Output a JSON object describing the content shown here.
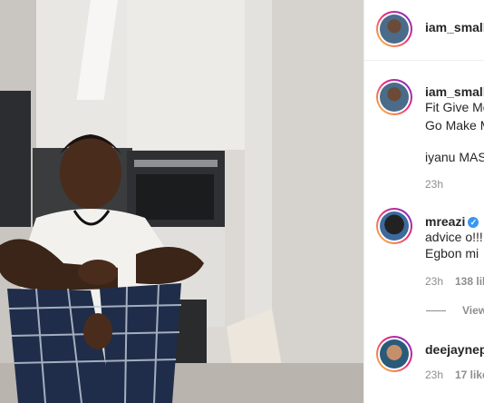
{
  "post": {
    "author": "iam_smallo"
  },
  "caption": {
    "author": "iam_small",
    "line1": "Fit Give Me",
    "line2": "Go Make M",
    "line3": "iyanu MAS",
    "time": "23h"
  },
  "comments": [
    {
      "author": "mreazi",
      "verified": true,
      "line1": "advice o!!!",
      "line2": "Egbon mi",
      "time": "23h",
      "likes": "138 lik"
    },
    {
      "author": "deejaynep",
      "time": "23h",
      "likes": "17 like"
    }
  ],
  "view_replies": "View",
  "colors": {
    "text": "#262626",
    "muted": "#8e8e8e",
    "verified": "#3897f0"
  }
}
